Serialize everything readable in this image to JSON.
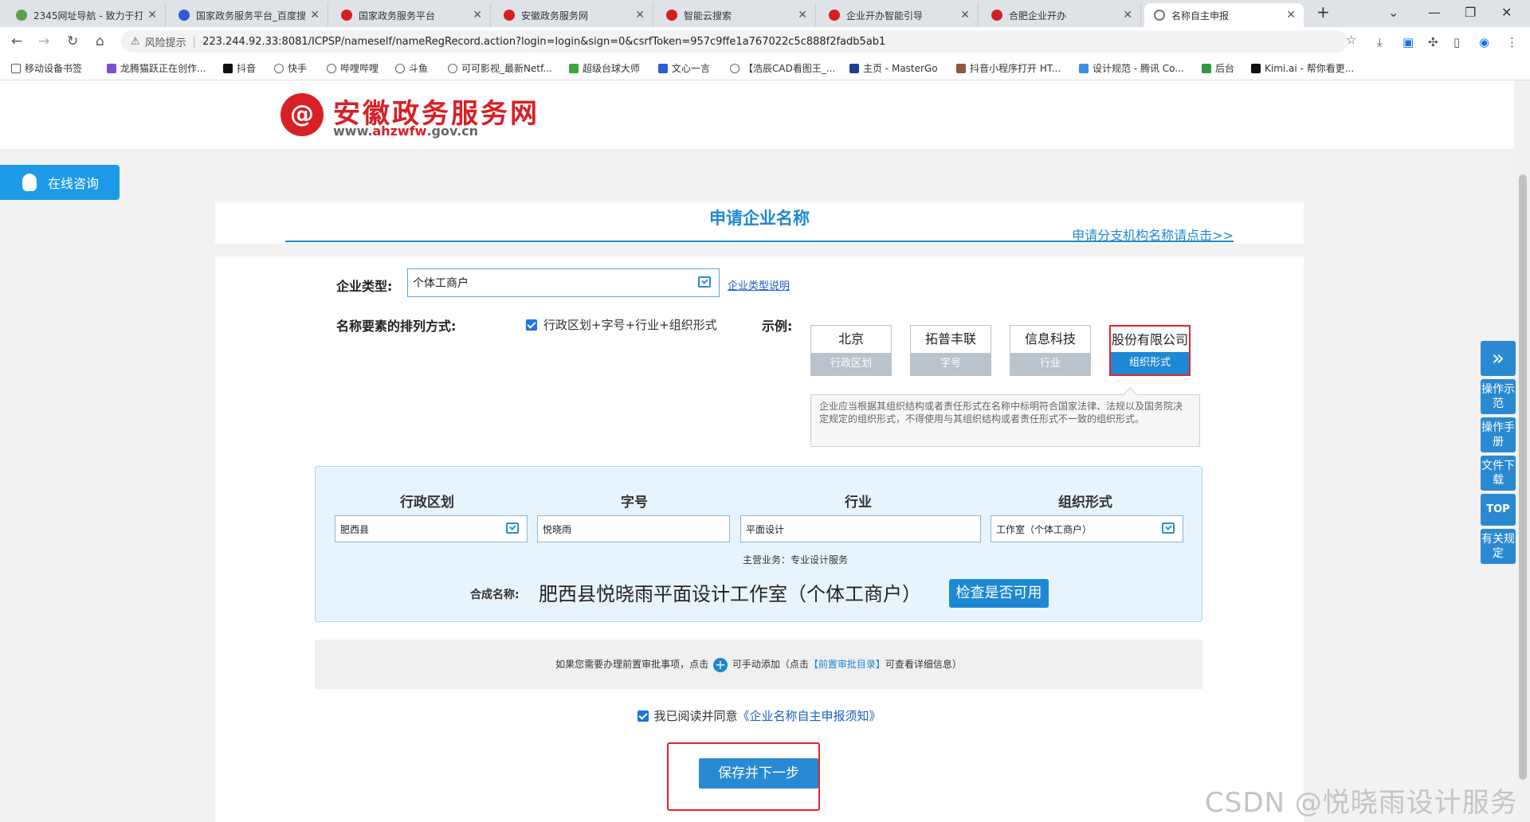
{
  "browser": {
    "tabs": [
      {
        "title": "2345网址导航 - 致力于打",
        "color": "#5aa14a"
      },
      {
        "title": "国家政务服务平台_百度搜",
        "color": "#2f5bd6"
      },
      {
        "title": "国家政务服务平台",
        "color": "#d31f23"
      },
      {
        "title": "安徽政务服务网",
        "color": "#d31f23"
      },
      {
        "title": "智能云搜索",
        "color": "#d31f23"
      },
      {
        "title": "企业开办智能引导",
        "color": "#d31f23"
      },
      {
        "title": "合肥企业开办",
        "color": "#d31f23"
      },
      {
        "title": "名称自主申报",
        "color": "#777777"
      }
    ],
    "risk_label": "风险提示",
    "url": "223.244.92.33:8081/ICPSP/nameself/nameRegRecord.action?login=login&sign=0&csrfToken=957c9ffe1a767022c5c888f2fadb5ab1",
    "bookmarks": [
      "移动设备书签",
      "龙腾猫跃正在创作...",
      "抖音",
      "快手",
      "哔哩哔哩",
      "斗鱼",
      "可可影视_最新Netf...",
      "超级台球大师",
      "文心一言",
      "【浩辰CAD看图王_...",
      "主页 - MasterGo",
      "抖音小程序打开 HT...",
      "设计规范 - 腾讯 Co...",
      "后台",
      "Kimi.ai - 帮你看更..."
    ]
  },
  "site": {
    "logo_title": "安徽政务服务网",
    "logo_url_prefix": "www.",
    "logo_url_brand": "ahzwfw",
    "logo_url_suffix": ".gov.cn",
    "consult": "在线咨询"
  },
  "form": {
    "title": "申请企业名称",
    "branch_link": "申请分支机构名称请点击>>",
    "type_label": "企业类型:",
    "type_value": "个体工商户",
    "type_help": "企业类型说明",
    "order_label": "名称要素的排列方式:",
    "order_value": "行政区划+字号+行业+组织形式",
    "example_label": "示例:",
    "examples": [
      {
        "value": "北京",
        "tag": "行政区划"
      },
      {
        "value": "拓普丰联",
        "tag": "字号"
      },
      {
        "value": "信息科技",
        "tag": "行业"
      },
      {
        "value": "股份有限公司",
        "tag": "组织形式"
      }
    ],
    "tip": "企业应当根据其组织结构或者责任形式在名称中标明符合国家法律、法规以及国务院决定规定的组织形式，不得使用与其组织结构或者责任形式不一致的组织形式。",
    "headers": [
      "行政区划",
      "字号",
      "行业",
      "组织形式"
    ],
    "values": [
      "肥西县",
      "悦晓雨",
      "平面设计",
      "工作室（个体工商户）"
    ],
    "main_business": "主营业务：专业设计服务",
    "synth_label": "合成名称:",
    "synth_value": "肥西县悦晓雨平面设计工作室（个体工商户）",
    "check_btn": "检查是否可用",
    "pre_text_1": "如果您需要办理前置审批事项，点击",
    "pre_text_2": "可手动添加（点击",
    "pre_catalog": "【前置审批目录】",
    "pre_text_3": "可查看详细信息）",
    "agree_text": "我已阅读并同意",
    "agree_link": "《企业名称自主申报须知》",
    "save_btn": "保存并下一步"
  },
  "float": {
    "demo": "操作示范",
    "manual": "操作手册",
    "download": "文件下载",
    "top": "TOP",
    "rules": "有关规定"
  },
  "watermark": "CSDN @悦晓雨设计服务",
  "colors": {
    "brand_red": "#d91f26",
    "accent_blue": "#1e88d2"
  }
}
